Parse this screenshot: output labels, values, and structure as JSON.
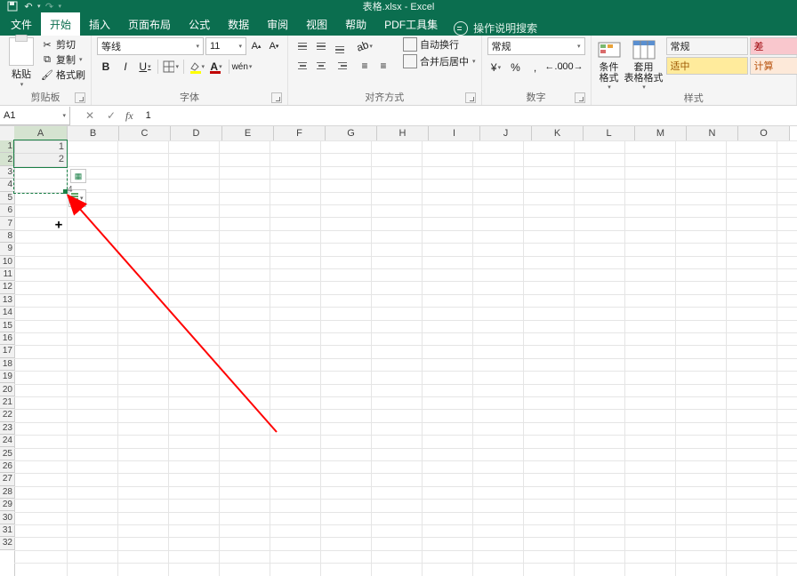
{
  "title": "表格.xlsx  -  Excel",
  "tabs": {
    "file": "文件",
    "home": "开始",
    "insert": "插入",
    "layout": "页面布局",
    "formulas": "公式",
    "data": "数据",
    "review": "审阅",
    "view": "视图",
    "help": "帮助",
    "pdf": "PDF工具集"
  },
  "tell_me": "操作说明搜索",
  "clipboard": {
    "paste": "粘贴",
    "cut": "剪切",
    "copy": "复制",
    "painter": "格式刷",
    "group": "剪贴板"
  },
  "font": {
    "name": "等线",
    "size": "11",
    "group": "字体",
    "bold": "B",
    "italic": "I",
    "underline": "U",
    "grow": "A",
    "shrink": "A"
  },
  "align": {
    "wrap": "自动换行",
    "merge": "合并后居中",
    "group": "对齐方式"
  },
  "number": {
    "format": "常规",
    "group": "数字",
    "currency": "¥",
    "percent": "%",
    "comma": ",",
    "inc": ".0",
    "dec": ".00"
  },
  "styles": {
    "condfmt": "条件格式",
    "tablefmt": "套用\n表格格式",
    "normal": "常规",
    "bad": "差",
    "good": "适中",
    "calc": "计算",
    "group": "样式"
  },
  "namebox": "A1",
  "formula": "1",
  "columns": [
    "A",
    "B",
    "C",
    "D",
    "E",
    "F",
    "G",
    "H",
    "I",
    "J",
    "K",
    "L",
    "M",
    "N",
    "O"
  ],
  "rows": [
    "1",
    "2",
    "3",
    "4",
    "5",
    "6",
    "7",
    "8",
    "9",
    "10",
    "11",
    "12",
    "13",
    "14",
    "15",
    "16",
    "17",
    "18",
    "19",
    "20",
    "21",
    "22",
    "23",
    "24",
    "25",
    "26",
    "27",
    "28",
    "29",
    "30",
    "31",
    "32"
  ],
  "cell_a1": "1",
  "cell_a2": "2",
  "autofill_preview": "4",
  "fill_cursor": "+"
}
